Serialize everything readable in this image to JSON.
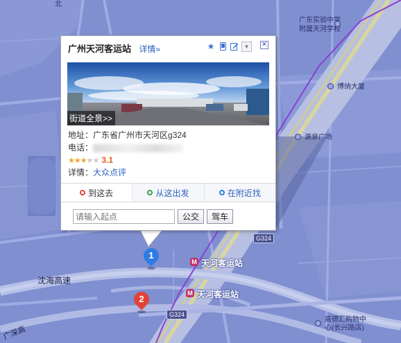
{
  "map": {
    "labels": {
      "school_line1": "广东实验中学",
      "school_line2": "附属天河学校",
      "bona": "博纳大厦",
      "yuanquan": "源泉广场",
      "g324_upper": "G324",
      "g324_lower": "G324",
      "shenhai": "沈海高速",
      "guangshen": "广深高",
      "mall_line1": "高德汇购物中",
      "mall_line2": "心(长兴路店)",
      "top_fragment": "北"
    },
    "stations": [
      {
        "name": "天河客运站",
        "icon": "metro-icon"
      },
      {
        "name": "天河客运站",
        "icon": "metro-icon"
      }
    ],
    "markers": [
      {
        "num": "1",
        "color": "#2f7be5"
      },
      {
        "num": "2",
        "color": "#e2423a"
      }
    ],
    "colors": {
      "map_bg": "#7f8fd0",
      "road": "#9aa7e2",
      "highway": "#c9c79a",
      "metro": "#8a3fd0"
    }
  },
  "infowindow": {
    "title": "广州天河客运站",
    "detail_link": "详情»",
    "tools": [
      "star-icon",
      "phone-icon",
      "edit-icon",
      "dropdown-icon"
    ],
    "photo_caption": "街道全景>>",
    "address_label": "地址：",
    "address_value": "广东省广州市天河区g324",
    "phone_label": "电话：",
    "rating": {
      "stars": 3,
      "max": 5,
      "score": "3.1"
    },
    "details_label": "详情：",
    "details_link": "大众点评",
    "tabs": [
      {
        "label": "到这去",
        "icon": "destination-icon"
      },
      {
        "label": "从这出发",
        "icon": "origin-icon"
      },
      {
        "label": "在附近找",
        "icon": "search-nearby-icon"
      }
    ],
    "route": {
      "placeholder": "请输入起点",
      "bus_button": "公交",
      "drive_button": "驾车"
    }
  }
}
